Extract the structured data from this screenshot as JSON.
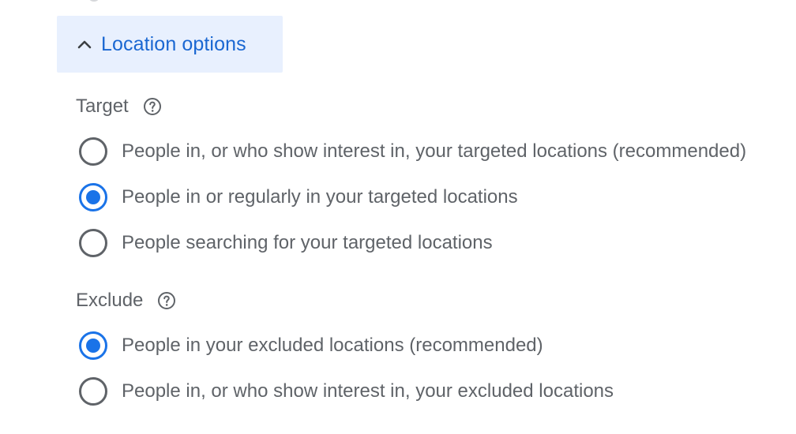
{
  "location_options": {
    "toggle_label": "Location options",
    "toggle_icon": "chevron-up-icon",
    "accent_color": "#1a73e8",
    "toggle_background": "#e8f0fe"
  },
  "target": {
    "heading": "Target",
    "help_icon": "help-circle-icon",
    "options": [
      {
        "label": "People in, or who show interest in, your targeted locations (recommended)",
        "selected": false
      },
      {
        "label": "People in or regularly in your targeted locations",
        "selected": true
      },
      {
        "label": "People searching for your targeted locations",
        "selected": false
      }
    ]
  },
  "exclude": {
    "heading": "Exclude",
    "help_icon": "help-circle-icon",
    "options": [
      {
        "label": "People in your excluded locations (recommended)",
        "selected": true
      },
      {
        "label": "People in, or who show interest in, your excluded locations",
        "selected": false
      }
    ]
  }
}
